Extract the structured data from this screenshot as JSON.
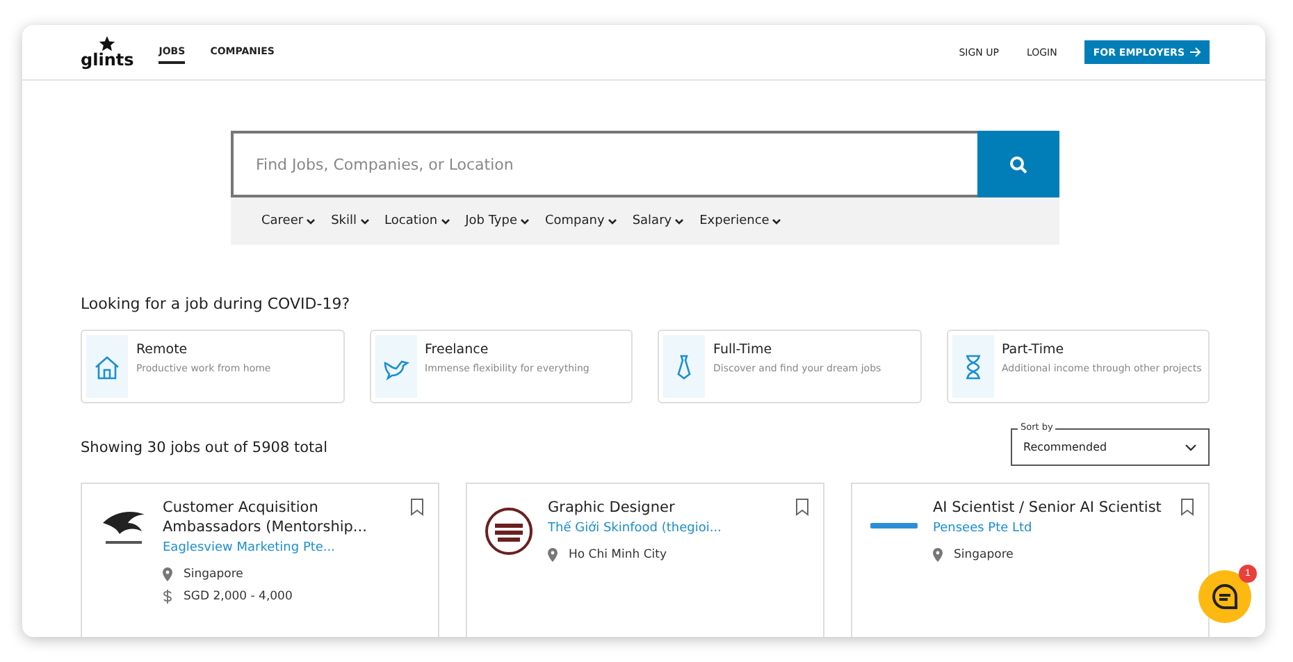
{
  "nav": {
    "logo": "glints",
    "links": [
      {
        "label": "JOBS",
        "selected": true
      },
      {
        "label": "COMPANIES",
        "selected": false
      }
    ],
    "right": [
      "SIGN UP",
      "LOGIN"
    ],
    "cta": "FOR EMPLOYERS"
  },
  "search": {
    "placeholder": "Find Jobs, Companies, or Location",
    "filters": [
      "Career",
      "Skill",
      "Location",
      "Job Type",
      "Company",
      "Salary",
      "Experience"
    ]
  },
  "covid": {
    "title": "Looking for a job during COVID-19?",
    "cards": [
      {
        "kind": "house",
        "title": "Remote",
        "text": "Productive work from home"
      },
      {
        "kind": "dove",
        "title": "Freelance",
        "text": "Immense flexibility for everything"
      },
      {
        "kind": "tie",
        "title": "Full-Time",
        "text": "Discover and find your dream jobs"
      },
      {
        "kind": "hourglass",
        "title": "Part-Time",
        "text": "Additional income through other projects"
      }
    ]
  },
  "results": {
    "summary": "Showing 30 jobs out of 5908 total",
    "sort": {
      "label": "Sort by",
      "value": "Recommended"
    }
  },
  "jobs": [
    {
      "kind": "eagle",
      "title": "Customer Acquisition Ambassadors (Mentorship...",
      "company": "Eaglesview Marketing Pte...",
      "location": "Singapore",
      "salary": "SGD 2,000 - 4,000"
    },
    {
      "kind": "food",
      "title": "Graphic Designer",
      "company": "Thế Giới Skinfood (thegioi...",
      "location": "Ho Chi Minh City"
    },
    {
      "kind": "wordmark",
      "title": "AI Scientist / Senior AI Scientist",
      "company": "Pensees Pte Ltd",
      "location": "Singapore"
    }
  ],
  "chat": {
    "badge": "1"
  }
}
